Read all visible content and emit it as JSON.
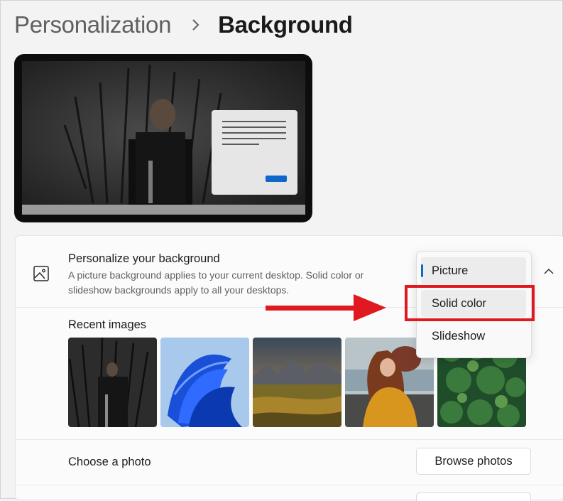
{
  "breadcrumb": {
    "parent": "Personalization",
    "current": "Background"
  },
  "personalize": {
    "title": "Personalize your background",
    "description": "A picture background applies to your current desktop. Solid color or slideshow backgrounds apply to all your desktops."
  },
  "dropdown": {
    "options": [
      "Picture",
      "Solid color",
      "Slideshow"
    ],
    "selected": "Picture"
  },
  "recent": {
    "label": "Recent images",
    "thumbnails": [
      "throne-portrait",
      "blue-bloom",
      "mountain-valley",
      "woman-yellow-coat",
      "forest-aerial"
    ]
  },
  "choose_photo": {
    "label": "Choose a photo",
    "button": "Browse photos"
  },
  "colors": {
    "accent": "#1166cc",
    "annotation": "#e0181f"
  }
}
